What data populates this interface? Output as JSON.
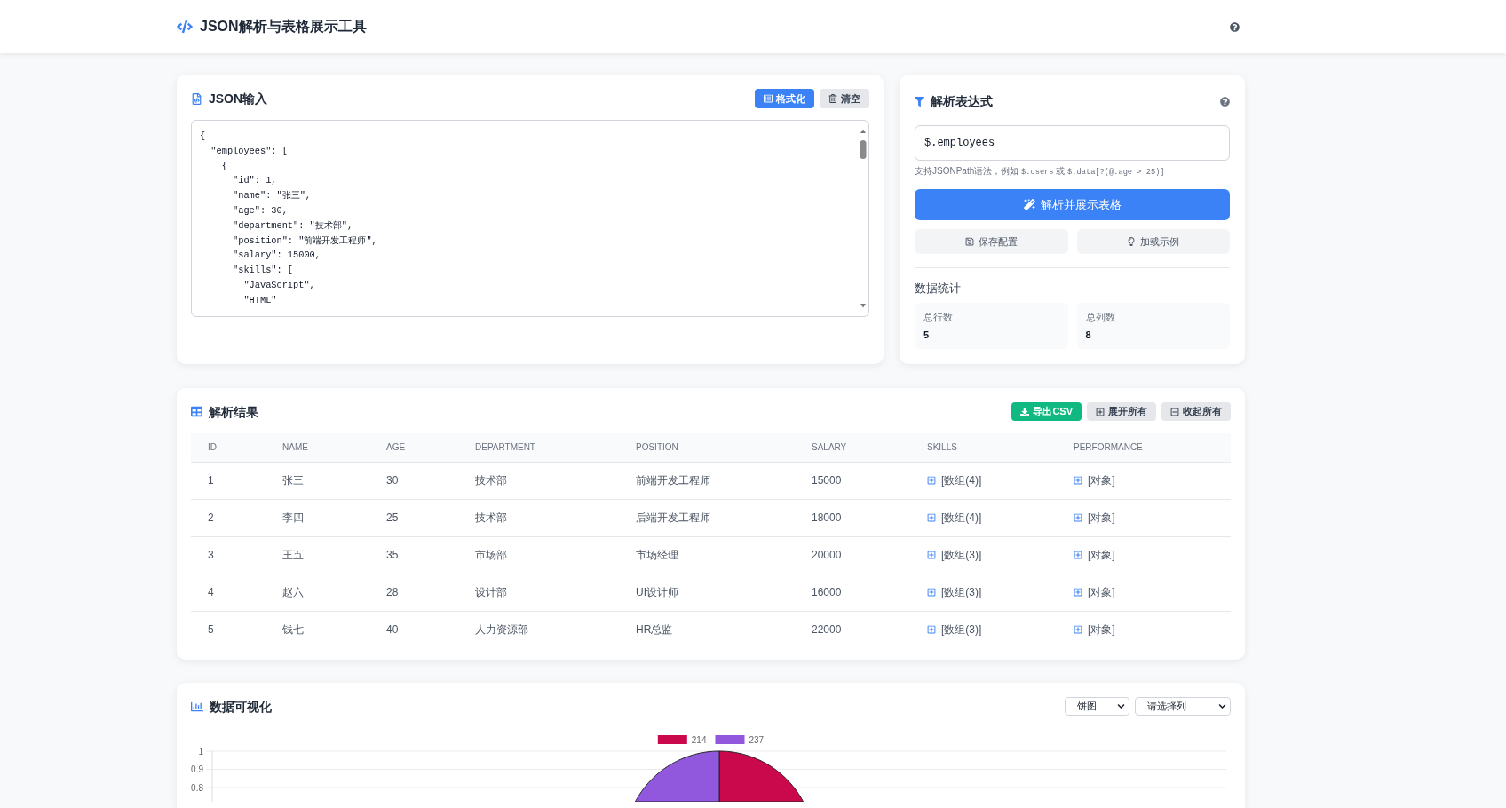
{
  "header": {
    "title": "JSON解析与表格展示工具"
  },
  "json_input": {
    "title": "JSON输入",
    "buttons": [
      {
        "kind": "format",
        "label": "格式化"
      },
      {
        "kind": "clear",
        "label": "清空"
      }
    ],
    "lines": [
      "{",
      "  \"employees\": [",
      "    {",
      "      \"id\": 1,",
      "      \"name\": \"张三\",",
      "      \"age\": 30,",
      "      \"department\": \"技术部\",",
      "      \"position\": \"前端开发工程师\",",
      "      \"salary\": 15000,",
      "      \"skills\": [",
      "        \"JavaScript\",",
      "        \"HTML\""
    ]
  },
  "expression": {
    "title": "解析表达式",
    "value": "$.employees",
    "hint": [
      {
        "kind": "text",
        "text": "支持JSONPath语法，例如"
      },
      {
        "kind": "code",
        "text": "$.users"
      },
      {
        "kind": "text",
        "text": "或"
      },
      {
        "kind": "code",
        "text": "$.data[?(@.age > 25)]"
      }
    ],
    "parse_button": "解析并展示表格",
    "buttons": [
      {
        "kind": "save",
        "label": "保存配置"
      },
      {
        "kind": "load",
        "label": "加载示例"
      }
    ],
    "stats_title": "数据统计",
    "stats": [
      {
        "label": "总行数",
        "value": "5"
      },
      {
        "label": "总列数",
        "value": "8"
      }
    ]
  },
  "results": {
    "title": "解析结果",
    "buttons": [
      {
        "kind": "export",
        "label": "导出CSV"
      },
      {
        "kind": "expand",
        "label": "展开所有"
      },
      {
        "kind": "collapse",
        "label": "收起所有"
      }
    ],
    "columns": [
      "ID",
      "NAME",
      "AGE",
      "DEPARTMENT",
      "POSITION",
      "SALARY",
      "SKILLS",
      "PERFORMANCE"
    ],
    "rows": [
      {
        "cells": [
          {
            "kind": "text",
            "text": "1"
          },
          {
            "kind": "text",
            "text": "张三"
          },
          {
            "kind": "text",
            "text": "30"
          },
          {
            "kind": "text",
            "text": "技术部"
          },
          {
            "kind": "text",
            "text": "前端开发工程师"
          },
          {
            "kind": "text",
            "text": "15000"
          },
          {
            "kind": "nested",
            "text": "[数组(4)]",
            "expanded": false
          },
          {
            "kind": "nested",
            "text": "[对象]",
            "expanded": false
          }
        ]
      },
      {
        "cells": [
          {
            "kind": "text",
            "text": "2"
          },
          {
            "kind": "text",
            "text": "李四"
          },
          {
            "kind": "text",
            "text": "25"
          },
          {
            "kind": "text",
            "text": "技术部"
          },
          {
            "kind": "text",
            "text": "后端开发工程师"
          },
          {
            "kind": "text",
            "text": "18000"
          },
          {
            "kind": "nested",
            "text": "[数组(4)]",
            "expanded": false
          },
          {
            "kind": "nested",
            "text": "[对象]",
            "expanded": false
          }
        ]
      },
      {
        "cells": [
          {
            "kind": "text",
            "text": "3"
          },
          {
            "kind": "text",
            "text": "王五"
          },
          {
            "kind": "text",
            "text": "35"
          },
          {
            "kind": "text",
            "text": "市场部"
          },
          {
            "kind": "text",
            "text": "市场经理"
          },
          {
            "kind": "text",
            "text": "20000"
          },
          {
            "kind": "nested",
            "text": "[数组(3)]",
            "expanded": false
          },
          {
            "kind": "nested",
            "text": "[对象]",
            "expanded": false
          }
        ]
      },
      {
        "cells": [
          {
            "kind": "text",
            "text": "4"
          },
          {
            "kind": "text",
            "text": "赵六"
          },
          {
            "kind": "text",
            "text": "28"
          },
          {
            "kind": "text",
            "text": "设计部"
          },
          {
            "kind": "text",
            "text": "UI设计师"
          },
          {
            "kind": "text",
            "text": "16000"
          },
          {
            "kind": "nested",
            "text": "[数组(3)]",
            "expanded": false
          },
          {
            "kind": "nested",
            "text": "[对象]",
            "expanded": false
          }
        ]
      },
      {
        "cells": [
          {
            "kind": "text",
            "text": "5"
          },
          {
            "kind": "text",
            "text": "钱七"
          },
          {
            "kind": "text",
            "text": "40"
          },
          {
            "kind": "text",
            "text": "人力资源部"
          },
          {
            "kind": "text",
            "text": "HR总监"
          },
          {
            "kind": "text",
            "text": "22000"
          },
          {
            "kind": "nested",
            "text": "[数组(3)]",
            "expanded": false
          },
          {
            "kind": "nested",
            "text": "[对象]",
            "expanded": false
          }
        ]
      }
    ]
  },
  "visualization": {
    "title": "数据可视化",
    "selects": [
      {
        "value": "饼图"
      },
      {
        "value": "请选择列"
      }
    ],
    "legend": [
      {
        "label": "214",
        "color": "#c9094b"
      },
      {
        "label": "237",
        "color": "#9158dd"
      }
    ],
    "y_axis_labels": [
      "1",
      "0.9",
      "0.8"
    ]
  }
}
